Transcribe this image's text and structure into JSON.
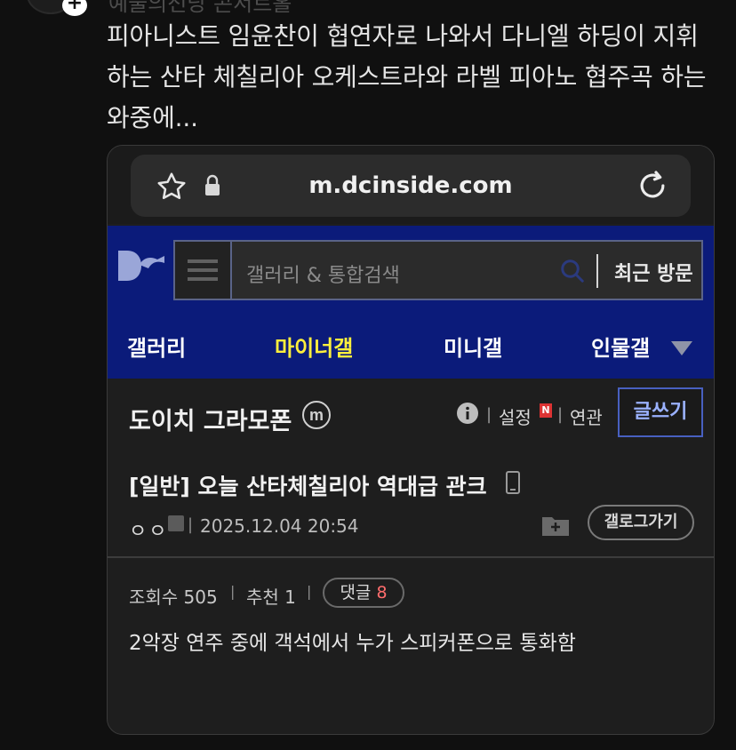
{
  "top": {
    "author_partial": "예술의전당 콘서트홀"
  },
  "post": {
    "text": "피아니스트 임윤찬이 협연자로 나와서 다니엘 하딩이 지휘하는 산타 체칠리아 오케스트라와 라벨 피아노 협주곡 하는 와중에..."
  },
  "browser": {
    "url": "m.dcinside.com",
    "icons": [
      "star-icon",
      "lock-icon",
      "reload-icon"
    ]
  },
  "dc": {
    "search_placeholder": "갤러리 & 통합검색",
    "recent_visit": "최근 방문",
    "nav": [
      "갤러리",
      "마이너갤",
      "미니갤",
      "인물갤"
    ],
    "active_nav": "마이너갤",
    "gallery_title": "도이치 그라모폰",
    "setting": "설정",
    "new_badge": "N",
    "related": "연관",
    "write": "글쓰기",
    "post_title": "[일반] 오늘 산타체칠리아 역대급 관크",
    "author": "ㅇㅇ",
    "date": "2025.12.04 20:54",
    "gallery_go": "갤로그가기",
    "views": "조회수 505",
    "recommend": "추천 1",
    "comment_label": "댓글",
    "comment_count": "8",
    "body": "2악장 연주 중에 객석에서 누가 스피커폰으로 통화함"
  },
  "colors": {
    "header_blue": "#0b1b7a",
    "active_yellow": "#ffef3c",
    "write_blue": "#9ab1ff",
    "comment_red": "#ff6d6d"
  }
}
